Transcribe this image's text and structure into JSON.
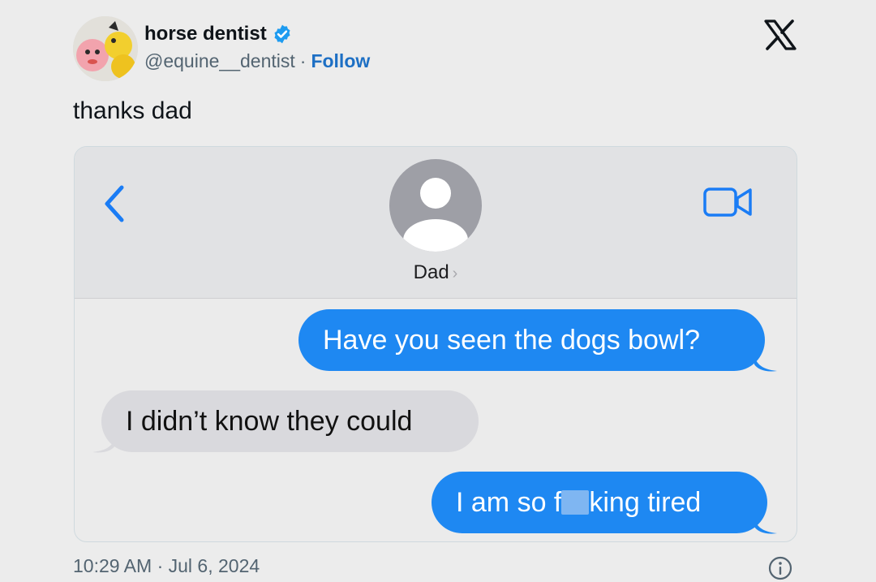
{
  "author": {
    "display_name": "horse dentist",
    "handle": "@equine__dentist",
    "separator": "·",
    "follow_label": "Follow",
    "verified_icon": "verified-badge-icon",
    "avatar": "avatar"
  },
  "brand_icon": "x-logo-icon",
  "tweet": {
    "text": "thanks dad"
  },
  "screenshot": {
    "header": {
      "back_icon": "chevron-left-icon",
      "contact_avatar_icon": "person-silhouette-icon",
      "contact_name": "Dad",
      "contact_chevron": "›",
      "video_icon": "video-camera-icon"
    },
    "messages": [
      {
        "direction": "sent",
        "text": "Have you seen the dogs bowl?"
      },
      {
        "direction": "received",
        "text": "I didn’t know they could"
      },
      {
        "direction": "sent",
        "text_before": "I am so f",
        "text_after": "king tired",
        "censored": true
      }
    ]
  },
  "footer": {
    "timestamp": "10:29 AM · Jul 6, 2024",
    "info_icon": "info-icon"
  },
  "colors": {
    "background": "#ececec",
    "sent_bubble": "#1e88f2",
    "received_bubble": "#d9d9dd",
    "follow_link": "#1d6fc4",
    "verified_badge": "#1d9bf0",
    "ios_blue": "#1a7cf5",
    "secondary_text": "#536471"
  }
}
